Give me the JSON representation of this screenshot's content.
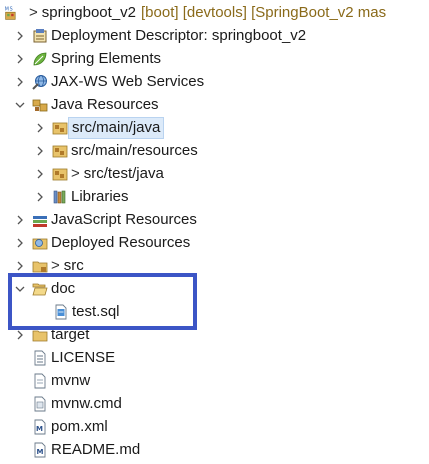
{
  "project": {
    "name": "springboot_v2",
    "decoration": "[boot] [devtools] [SpringBoot_v2 mas",
    "badge": "M·S"
  },
  "items": [
    {
      "label": "Deployment Descriptor: springboot_v2"
    },
    {
      "label": "Spring Elements"
    },
    {
      "label": "JAX-WS Web Services"
    },
    {
      "label": "Java Resources"
    },
    {
      "label": "src/main/java"
    },
    {
      "label": "src/main/resources"
    },
    {
      "label": "src/test/java"
    },
    {
      "label": "Libraries"
    },
    {
      "label": "JavaScript Resources"
    },
    {
      "label": "Deployed Resources"
    },
    {
      "label": "src"
    },
    {
      "label": "doc"
    },
    {
      "label": "test.sql"
    },
    {
      "label": "target"
    },
    {
      "label": "LICENSE"
    },
    {
      "label": "mvnw"
    },
    {
      "label": "mvnw.cmd"
    },
    {
      "label": "pom.xml"
    },
    {
      "label": "README.md"
    }
  ],
  "colors": {
    "highlight_border": "#3c55c6",
    "selection_bg": "#dceaf9",
    "folder": "#e8c36a",
    "package_root": "#b07a2a"
  }
}
